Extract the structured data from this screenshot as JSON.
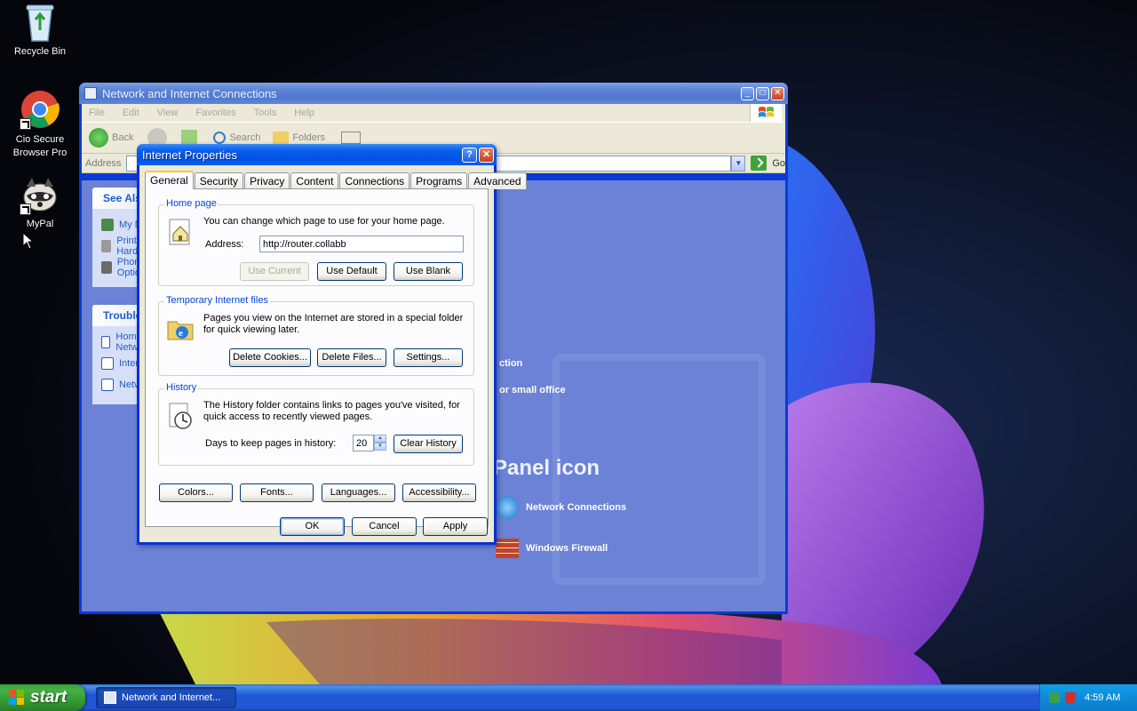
{
  "desktop": {
    "icons": [
      {
        "label": "Recycle Bin"
      },
      {
        "label": "Cio Secure Browser Pro"
      },
      {
        "label": "MyPal"
      }
    ]
  },
  "explorer": {
    "title": "Network and Internet Connections",
    "menu": [
      "File",
      "Edit",
      "View",
      "Favorites",
      "Tools",
      "Help"
    ],
    "toolbar": {
      "back": "Back",
      "search": "Search",
      "folders": "Folders"
    },
    "address_label": "Address",
    "go_label": "Go",
    "see_also_title": "See Also",
    "see_also_items": [
      "My Network Places",
      "Printers and Other Hardware",
      "Phone and Modem Options"
    ],
    "troubleshooters_title": "Troubleshooters",
    "troubleshooter_items": [
      "Home or Small Office Networking",
      "Internet Explorer",
      "Network Diagnostics"
    ],
    "tasks_partial": [
      "ction",
      "or small office"
    ],
    "cp_heading": "Panel icon",
    "cp_icons": [
      "Network Connections",
      "Windows Firewall"
    ]
  },
  "dialog": {
    "title": "Internet Properties",
    "tabs": [
      "General",
      "Security",
      "Privacy",
      "Content",
      "Connections",
      "Programs",
      "Advanced"
    ],
    "active_tab": "General",
    "home_page": {
      "label": "Home page",
      "description": "You can change which page to use for your home page.",
      "address_label": "Address:",
      "address_value": "http://router.collabb",
      "use_current": "Use Current",
      "use_default": "Use Default",
      "use_blank": "Use Blank"
    },
    "temp_files": {
      "label": "Temporary Internet files",
      "description": "Pages you view on the Internet are stored in a special folder for quick viewing later.",
      "delete_cookies": "Delete Cookies...",
      "delete_files": "Delete Files...",
      "settings": "Settings..."
    },
    "history": {
      "label": "History",
      "description": "The History folder contains links to pages you've visited, for quick access to recently viewed pages.",
      "days_label": "Days to keep pages in history:",
      "days_value": "20",
      "clear_history": "Clear History"
    },
    "bottom_buttons": {
      "colors": "Colors...",
      "fonts": "Fonts...",
      "languages": "Languages...",
      "accessibility": "Accessibility..."
    },
    "ok": "OK",
    "cancel": "Cancel",
    "apply": "Apply"
  },
  "taskbar": {
    "start_label": "start",
    "task_label": "Network and Internet...",
    "clock": "4:59 AM"
  }
}
